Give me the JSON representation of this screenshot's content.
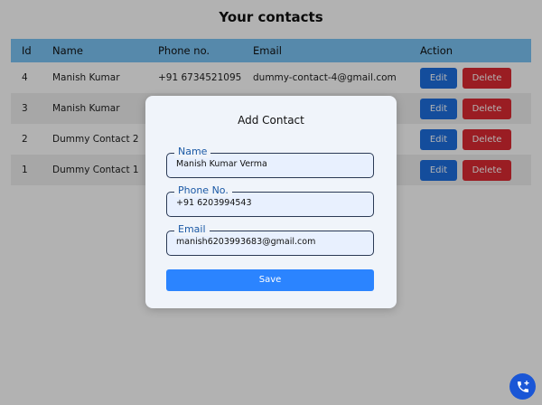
{
  "page": {
    "title": "Your contacts"
  },
  "table": {
    "headers": [
      "Id",
      "Name",
      "Phone no.",
      "Email",
      "Action"
    ],
    "rows": [
      {
        "id": "4",
        "name": "Manish Kumar",
        "phone": "+91 6734521095",
        "email": "dummy-contact-4@gmail.com"
      },
      {
        "id": "3",
        "name": "Manish Kumar",
        "phone": "",
        "email": ""
      },
      {
        "id": "2",
        "name": "Dummy Contact 2",
        "phone": "",
        "email": ""
      },
      {
        "id": "1",
        "name": "Dummy Contact 1",
        "phone": "",
        "email": ""
      }
    ],
    "edit_label": "Edit",
    "delete_label": "Delete"
  },
  "modal": {
    "title": "Add Contact",
    "fields": {
      "name": {
        "label": "Name",
        "value": "Manish Kumar Verma"
      },
      "phone": {
        "label": "Phone No.",
        "value": "+91 6203994543"
      },
      "email": {
        "label": "Email",
        "value": "manish6203993683@gmail.com"
      }
    },
    "save_label": "Save"
  },
  "fab": {
    "icon": "phone-add-icon"
  },
  "colors": {
    "header": "#7cc4f5",
    "edit": "#1e6fe0",
    "delete": "#dd2a33",
    "save": "#2b84ff",
    "fab": "#1a56d6"
  }
}
